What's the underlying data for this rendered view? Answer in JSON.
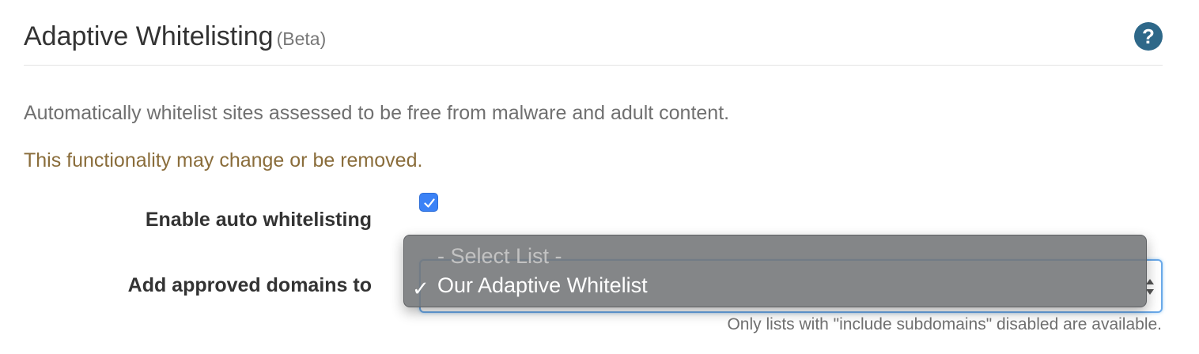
{
  "header": {
    "title": "Adaptive Whitelisting",
    "badge": "(Beta)",
    "help_glyph": "?"
  },
  "description": "Automatically whitelist sites assessed to be free from malware and adult content.",
  "warning": "This functionality may change or be removed.",
  "form": {
    "enable_label": "Enable auto whitelisting",
    "enable_checked": true,
    "add_label": "Add approved domains to",
    "select": {
      "options": [
        "- Select List -",
        "Our Adaptive Whitelist"
      ],
      "selected": "Our Adaptive Whitelist",
      "checkmark": "✓"
    },
    "hint": "Only lists with \"include subdomains\" disabled are available."
  },
  "colors": {
    "warning": "#8a6d3b",
    "help_icon_bg": "#2e6889",
    "checkbox": "#3b82f6",
    "focus_border": "#6aa9e9"
  }
}
